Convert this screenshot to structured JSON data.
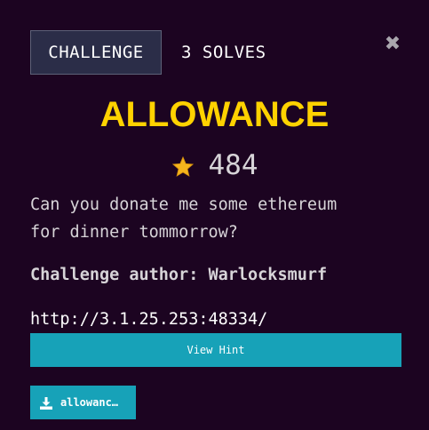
{
  "tabs": {
    "challenge_label": "CHALLENGE",
    "solves_label": "3 SOLVES"
  },
  "close_icon": "close-icon",
  "challenge": {
    "title": "ALLOWANCE",
    "points": "484",
    "description_line1": "Can you donate me some ethereum",
    "description_line2": "for dinner tommorrow?",
    "author": "Challenge author: Warlocksmurf",
    "url": "http://3.1.25.253:48334/"
  },
  "buttons": {
    "hint_label": "View Hint",
    "download_label": "allowanc…"
  },
  "icons": {
    "star": "star-icon",
    "download": "download-icon"
  },
  "colors": {
    "background": "#1c0421",
    "title": "#ffd200",
    "accent": "#17a2b8",
    "tab_bg": "#2b2d48"
  }
}
